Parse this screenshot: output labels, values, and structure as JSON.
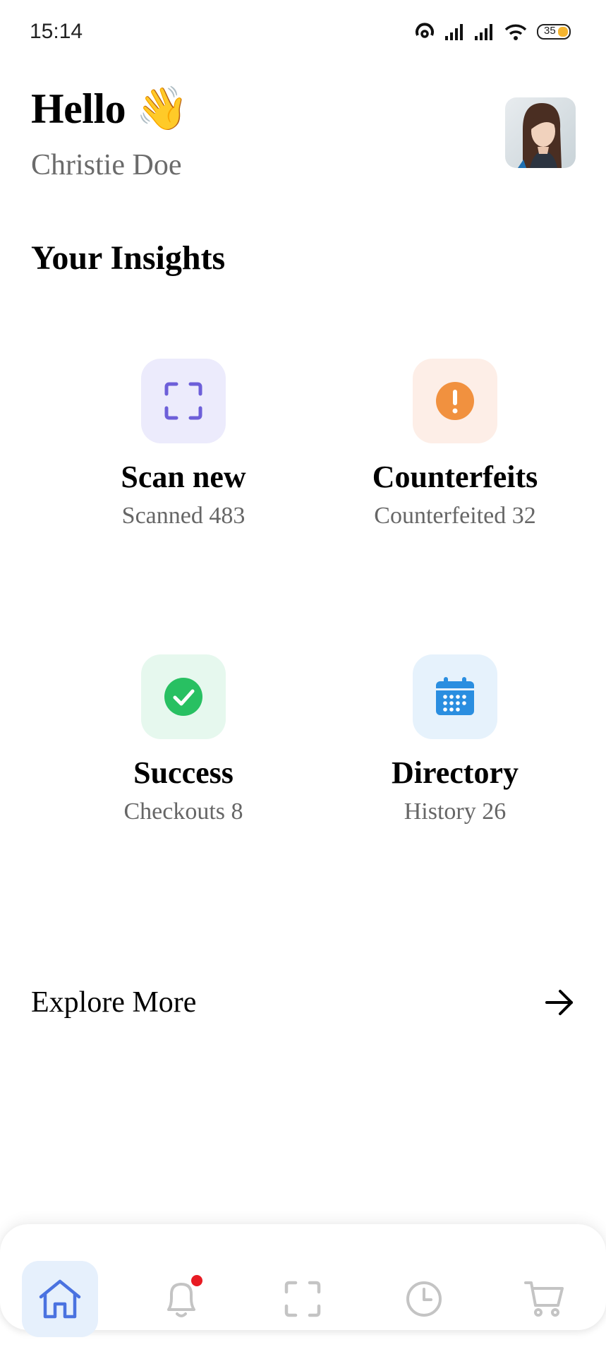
{
  "status_bar": {
    "time": "15:14",
    "battery_level": "35"
  },
  "header": {
    "greeting": "Hello 👋",
    "user_name": "Christie Doe"
  },
  "insights": {
    "title": "Your Insights",
    "cards": [
      {
        "title": "Scan new",
        "subtitle": "Scanned 483",
        "icon": "scan-icon",
        "tile_color": "#ecebfc",
        "icon_color": "#6d5fd9"
      },
      {
        "title": "Counterfeits",
        "subtitle": "Counterfeited 32",
        "icon": "alert-icon",
        "tile_color": "#fdeee7",
        "icon_color": "#f1913f"
      },
      {
        "title": "Success",
        "subtitle": "Checkouts 8",
        "icon": "check-icon",
        "tile_color": "#e6f8ee",
        "icon_color": "#28c062"
      },
      {
        "title": "Directory",
        "subtitle": "History 26",
        "icon": "calendar-icon",
        "tile_color": "#e6f2fc",
        "icon_color": "#2a8ee0"
      }
    ]
  },
  "explore": {
    "label": "Explore More"
  },
  "bottom_nav": {
    "items": [
      "home-icon",
      "bell-icon",
      "scan-icon",
      "clock-icon",
      "cart-icon"
    ],
    "active": "home-icon",
    "accent": "#4a72e0"
  }
}
